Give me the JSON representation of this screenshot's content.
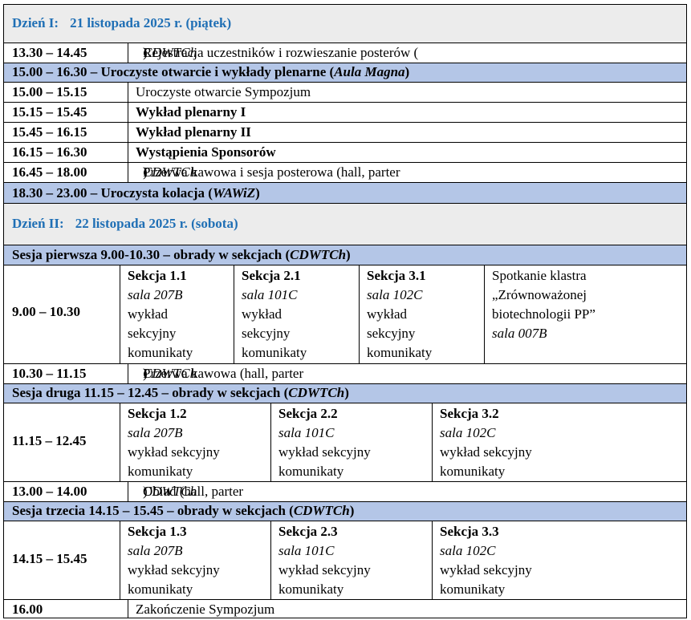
{
  "day1": {
    "label": "Dzień I:",
    "date": "21 listopada 2025 r. (piątek)",
    "rows": [
      {
        "time": "13.30 – 14.45",
        "pre": "Rejestracja uczestników i rozwieszanie posterów (",
        "it": "CDWTCh",
        "post": ")",
        "bold": false
      },
      {
        "time": "15.00 – 15.15",
        "pre": "Uroczyste otwarcie Sympozjum",
        "it": "",
        "post": "",
        "bold": false
      },
      {
        "time": "15.15 – 15.45",
        "pre": "Wykład plenarny I",
        "it": "",
        "post": "",
        "bold": true
      },
      {
        "time": "15.45 – 16.15",
        "pre": "Wykład plenarny II",
        "it": "",
        "post": "",
        "bold": true
      },
      {
        "time": "16.15 – 16.30",
        "pre": "Wystąpienia Sponsorów",
        "it": "",
        "post": "",
        "bold": true
      },
      {
        "time": "16.45 – 18.00",
        "pre": "Przerwa kawowa i sesja posterowa (hall, parter ",
        "it": "CDWTCh",
        "post": ")",
        "bold": false
      }
    ],
    "opening_band": {
      "pre": "15.00 – 16.30 – Uroczyste otwarcie i wykłady plenarne (",
      "it": "Aula Magna",
      "post": ")"
    },
    "dinner_band": {
      "pre": "18.30 – 23.00 – Uroczysta kolacja (",
      "it": "WAWiZ",
      "post": ")"
    }
  },
  "day2": {
    "label": "Dzień II:",
    "date": "22 listopada 2025 r. (sobota)",
    "session1": {
      "band": {
        "pre": "Sesja pierwsza 9.00-10.30 – obrady w sekcjach (",
        "it": "CDWTCh",
        "post": ")"
      },
      "time": "9.00 – 10.30",
      "cells": [
        {
          "title": "Sekcja 1.1",
          "room": "sala 207B",
          "lines": [
            "wykład",
            "sekcyjny",
            "komunikaty"
          ]
        },
        {
          "title": "Sekcja 2.1",
          "room": "sala 101C",
          "lines": [
            "wykład",
            "sekcyjny",
            "komunikaty"
          ]
        },
        {
          "title": "Sekcja 3.1",
          "room": "sala 102C",
          "lines": [
            "wykład",
            "sekcyjny",
            "komunikaty"
          ]
        }
      ],
      "cluster": {
        "lines": [
          "Spotkanie klastra",
          "„Zrównoważonej",
          "biotechnologii PP”"
        ],
        "room": "sala 007B"
      }
    },
    "break1": {
      "time": "10.30 – 11.15",
      "pre": "Przerwa kawowa (hall, parter ",
      "it": "CDWTCh",
      "post": ")"
    },
    "session2": {
      "band": {
        "pre": "Sesja druga 11.15 – 12.45 – obrady w sekcjach (",
        "it": "CDWTCh",
        "post": ")"
      },
      "time": "11.15 – 12.45",
      "cells": [
        {
          "title": "Sekcja 1.2",
          "room": "sala 207B",
          "lines": [
            "wykład sekcyjny",
            "komunikaty"
          ]
        },
        {
          "title": "Sekcja 2.2",
          "room": "sala 101C",
          "lines": [
            "wykład sekcyjny",
            "komunikaty"
          ]
        },
        {
          "title": "Sekcja 3.2",
          "room": "sala 102C",
          "lines": [
            "wykład sekcyjny",
            "komunikaty"
          ]
        }
      ]
    },
    "lunch": {
      "time": "13.00 – 14.00",
      "pre": "Obiad (hall, parter ",
      "it": "CDWTCh",
      "post": ")"
    },
    "session3": {
      "band": {
        "pre": "Sesja trzecia 14.15 – 15.45 – obrady w sekcjach (",
        "it": "CDWTCh",
        "post": ")"
      },
      "time": "14.15 – 15.45",
      "cells": [
        {
          "title": "Sekcja 1.3",
          "room": "sala 207B",
          "lines": [
            "wykład sekcyjny",
            "komunikaty"
          ]
        },
        {
          "title": "Sekcja 2.3",
          "room": "sala 101C",
          "lines": [
            "wykład sekcyjny",
            "komunikaty"
          ]
        },
        {
          "title": "Sekcja 3.3",
          "room": "sala 102C",
          "lines": [
            "wykład sekcyjny",
            "komunikaty"
          ]
        }
      ]
    },
    "closing": {
      "time": "16.00",
      "text": "Zakończenie Sympozjum"
    }
  },
  "colors": {
    "day_heading": "#1f6fb5",
    "band_fill": "#b4c6e7",
    "day_fill": "#ececec"
  }
}
